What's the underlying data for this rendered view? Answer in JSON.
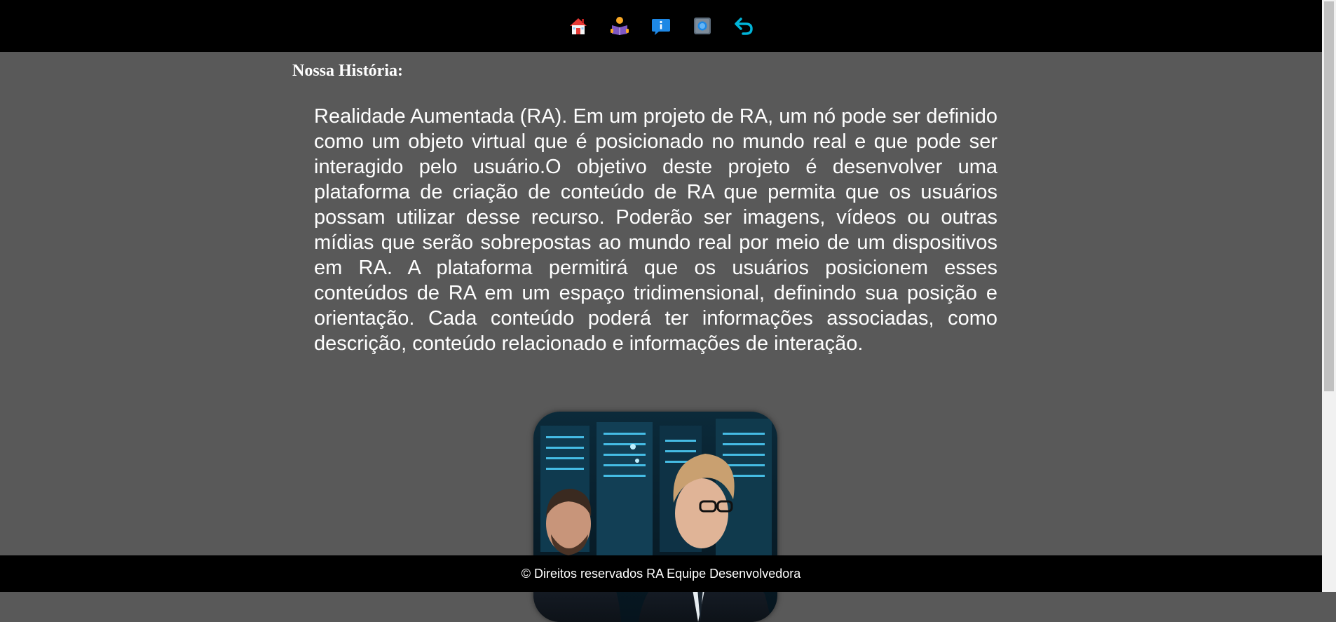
{
  "nav": {
    "items": [
      {
        "icon": "home-icon",
        "color": "#e53935"
      },
      {
        "icon": "reader-icon",
        "color": "#7e57c2"
      },
      {
        "icon": "info-icon",
        "color": "#1e88e5"
      },
      {
        "icon": "record-icon",
        "color": "#5c6b7a"
      },
      {
        "icon": "back-arrow-icon",
        "color": "#00b4d8"
      }
    ]
  },
  "main": {
    "heading": "Nossa História:",
    "paragraph": "Realidade Aumentada (RA). Em um projeto de RA, um nó pode ser definido como um objeto virtual que é posicionado no mundo real e que pode ser interagido pelo usuário.O objetivo deste projeto é desenvolver uma plataforma de criação de conteúdo de RA que permita que os usuários possam utilizar desse recurso. Poderão ser imagens, vídeos ou outras mídias que serão sobrepostas ao mundo real por meio de um dispositivos em RA. A plataforma permitirá que os usuários posicionem esses conteúdos de RA em um espaço tridimensional, definindo sua posição e orientação. Cada conteúdo poderá ter informações associadas, como descrição, conteúdo relacionado e informações de interação."
  },
  "footer": {
    "text": "© Direitos reservados RA Equipe Desenvolvedora"
  },
  "colors": {
    "background": "#595959",
    "bar": "#000000",
    "text": "#ffffff"
  }
}
